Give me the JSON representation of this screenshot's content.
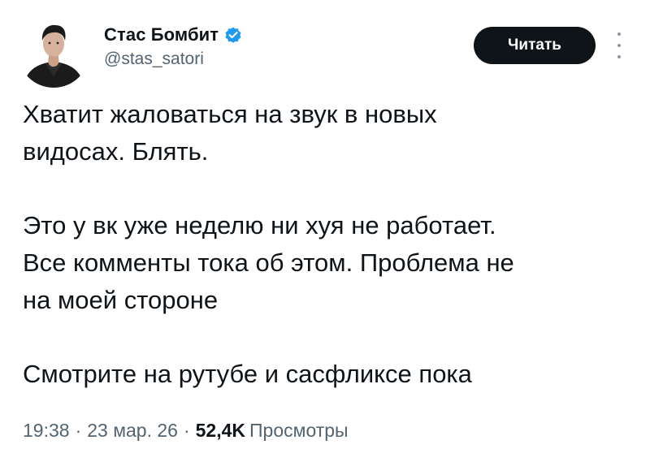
{
  "author": {
    "display_name": "Стас Бомбит",
    "handle": "@stas_satori",
    "verified": true,
    "verified_color": "#1d9bf0"
  },
  "actions": {
    "follow_label": "Читать",
    "more_icon": "more-vertical-icon"
  },
  "tweet": {
    "paragraphs": [
      "Хватит жаловаться на звук в новых\nвидосах. Блять.",
      "Это у вк уже неделю ни хуя не работает.\nВсе комменты тока об этом. Проблема не\nна моей стороне",
      "Смотрите на рутубе и сасфликсе пока"
    ]
  },
  "meta": {
    "time": "19:38",
    "date": "23 мар. 26",
    "separator": "·",
    "views_count": "52,4K",
    "views_label": "Просмотры"
  },
  "colors": {
    "text_primary": "#0f1419",
    "text_secondary": "#536471",
    "button_bg": "#0f1419",
    "button_text": "#ffffff"
  }
}
